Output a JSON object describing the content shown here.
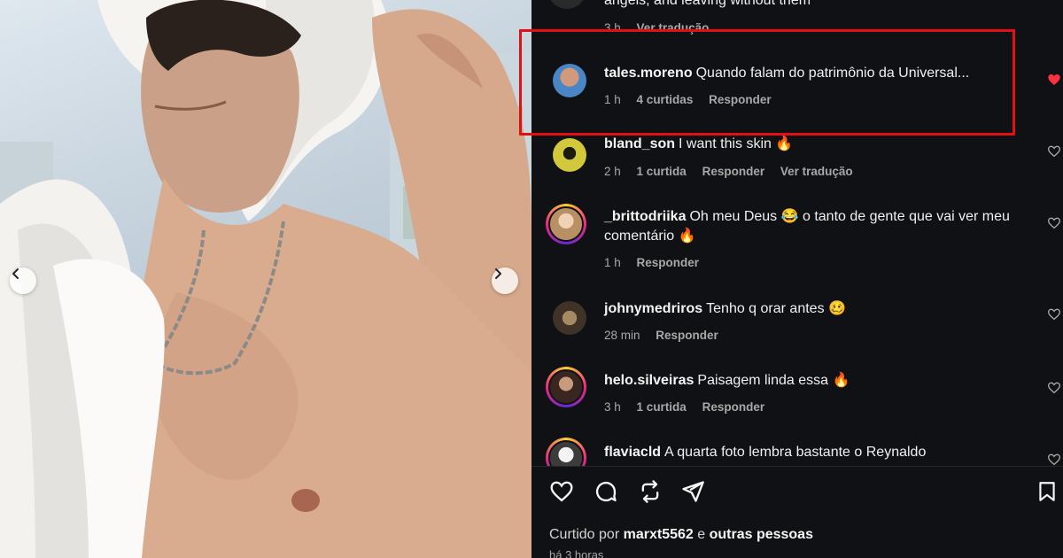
{
  "carousel": {
    "prev_icon": "chevron-left-icon",
    "next_icon": "chevron-right-icon"
  },
  "partial_comment": {
    "text": "angels, and leaving without them",
    "time": "3 h",
    "translate": "Ver tradução"
  },
  "comments": [
    {
      "user": "tales.moreno",
      "text": "Quando falam do patrimônio da Universal...",
      "time": "1 h",
      "likes": "4 curtidas",
      "reply": "Responder",
      "translate": "",
      "liked": true,
      "avatar_color": "#4a86c5",
      "ring": false
    },
    {
      "user": "bland_son",
      "text": "I want this skin 🔥",
      "time": "2 h",
      "likes": "1 curtida",
      "reply": "Responder",
      "translate": "Ver tradução",
      "liked": false,
      "avatar_color": "#c9c23a",
      "ring": false
    },
    {
      "user": "_brittodriika",
      "text": "Oh meu Deus 😂 o tanto de gente que vai ver meu comentário 🔥",
      "time": "1 h",
      "likes": "",
      "reply": "Responder",
      "translate": "",
      "liked": false,
      "avatar_color": "#c8a37a",
      "ring": true
    },
    {
      "user": "johnymedriros",
      "text": "Tenho q orar antes 🥴",
      "time": "28 min",
      "likes": "",
      "reply": "Responder",
      "translate": "",
      "liked": false,
      "avatar_color": "#6b5a42",
      "ring": false
    },
    {
      "user": "helo.silveiras",
      "text": "Paisagem linda essa 🔥",
      "time": "3 h",
      "likes": "1 curtida",
      "reply": "Responder",
      "translate": "",
      "liked": false,
      "avatar_color": "#5a4036",
      "ring": true
    },
    {
      "user": "flaviacld",
      "text": "A quarta foto lembra bastante o Reynaldo",
      "time": "",
      "likes": "",
      "reply": "",
      "translate": "",
      "liked": false,
      "avatar_color": "#d8d8d8",
      "ring": true
    }
  ],
  "actions": {
    "like_icon": "heart-icon",
    "comment_icon": "comment-icon",
    "repost_icon": "repost-icon",
    "share_icon": "send-icon",
    "save_icon": "bookmark-icon"
  },
  "liked_by": {
    "prefix": "Curtido por",
    "user": "marxt5562",
    "connector": "e",
    "others": "outras pessoas"
  },
  "time_ago": "há 3 horas",
  "colors": {
    "panel_bg": "#101114",
    "highlight": "#e30f12",
    "liked_heart": "#ff3040",
    "meta": "#a8a8a8"
  }
}
